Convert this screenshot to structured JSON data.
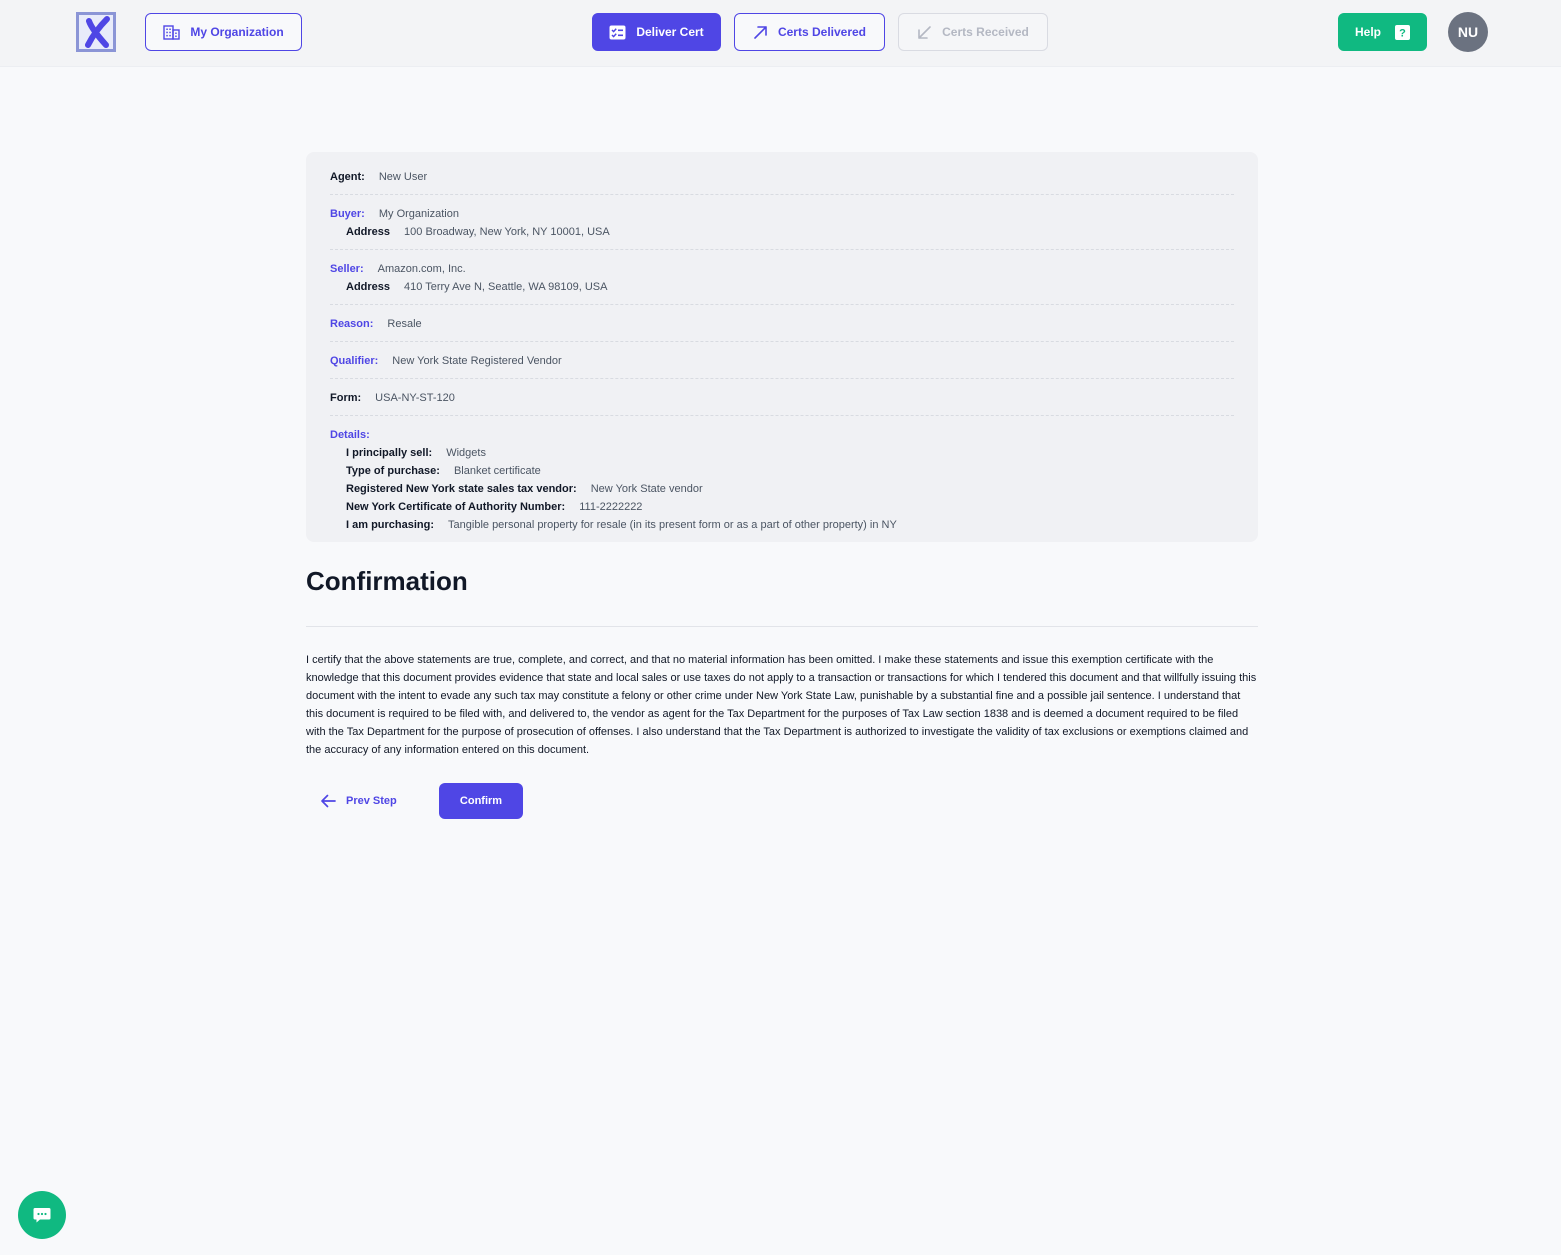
{
  "colors": {
    "brand": "#4f46e5",
    "help": "#10b981",
    "avatar_bg": "#6b7280",
    "page_bg": "#f8f9fb"
  },
  "header": {
    "logo_icon": "x-logo-icon",
    "org_button": {
      "label": "My Organization",
      "icon": "building-icon"
    },
    "deliver_button": {
      "label": "Deliver Cert",
      "icon": "list-check-icon"
    },
    "delivered_button": {
      "label": "Certs Delivered",
      "icon": "arrow-up-right-icon"
    },
    "received_button": {
      "label": "Certs Received",
      "icon": "arrow-down-left-icon"
    },
    "help_button": {
      "label": "Help",
      "icon": "question-mark-icon"
    },
    "avatar_initials": "NU"
  },
  "summary": {
    "agent": {
      "label": "Agent:",
      "value": "New User"
    },
    "buyer": {
      "label": "Buyer:",
      "value": "My Organization",
      "address_label": "Address",
      "address": "100 Broadway, New York, NY 10001, USA"
    },
    "seller": {
      "label": "Seller:",
      "value": "Amazon.com, Inc.",
      "address_label": "Address",
      "address": "410 Terry Ave N, Seattle, WA 98109, USA"
    },
    "reason": {
      "label": "Reason:",
      "value": "Resale"
    },
    "qualifier": {
      "label": "Qualifier:",
      "value": "New York State Registered Vendor"
    },
    "form": {
      "label": "Form:",
      "value": "USA-NY-ST-120"
    },
    "details": {
      "label": "Details:",
      "items": [
        {
          "label": "I principally sell:",
          "value": "Widgets"
        },
        {
          "label": "Type of purchase:",
          "value": "Blanket certificate"
        },
        {
          "label": "Registered New York state sales tax vendor:",
          "value": "New York State vendor"
        },
        {
          "label": "New York Certificate of Authority Number:",
          "value": "111-2222222"
        },
        {
          "label": "I am purchasing:",
          "value": "Tangible personal property for resale (in its present form or as a part of other property) in NY"
        }
      ]
    }
  },
  "confirmation": {
    "title": "Confirmation",
    "text": "I certify that the above statements are true, complete, and correct, and that no material information has been omitted. I make these statements and issue this exemption certificate with the knowledge that this document provides evidence that state and local sales or use taxes do not apply to a transaction or transactions for which I tendered this document and that willfully issuing this document with the intent to evade any such tax may constitute a felony or other crime under New York State Law, punishable by a substantial fine and a possible jail sentence. I understand that this document is required to be filed with, and delivered to, the vendor as agent for the Tax Department for the purposes of Tax Law section 1838 and is deemed a document required to be filed with the Tax Department for the purpose of prosecution of offenses. I also understand that the Tax Department is authorized to investigate the validity of tax exclusions or exemptions claimed and the accuracy of any information entered on this document.",
    "prev_label": "Prev Step",
    "prev_icon": "arrow-left-icon",
    "confirm_label": "Confirm"
  },
  "chat": {
    "icon": "chat-bubble-icon"
  }
}
